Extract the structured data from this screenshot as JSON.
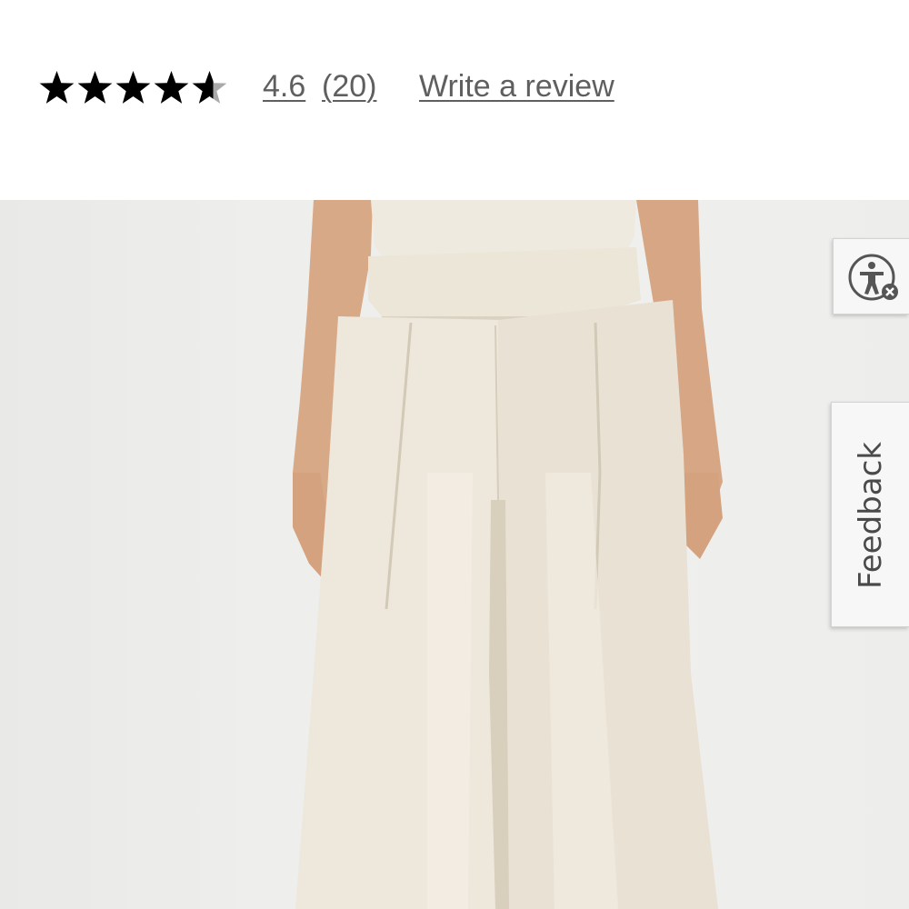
{
  "rating": {
    "value": "4.6",
    "count": "(20)",
    "stars_filled": 4.6,
    "stars_total": 5,
    "write_review_label": "Write a review"
  },
  "side_tabs": {
    "accessibility_icon": "accessibility-icon",
    "feedback_label": "Feedback"
  },
  "product_image": {
    "description_icon": "product-photo"
  },
  "colors": {
    "star": "#000000",
    "star_empty": "#a9a9a9",
    "link": "#5f5f5f",
    "tab_bg": "#f7f7f7"
  }
}
